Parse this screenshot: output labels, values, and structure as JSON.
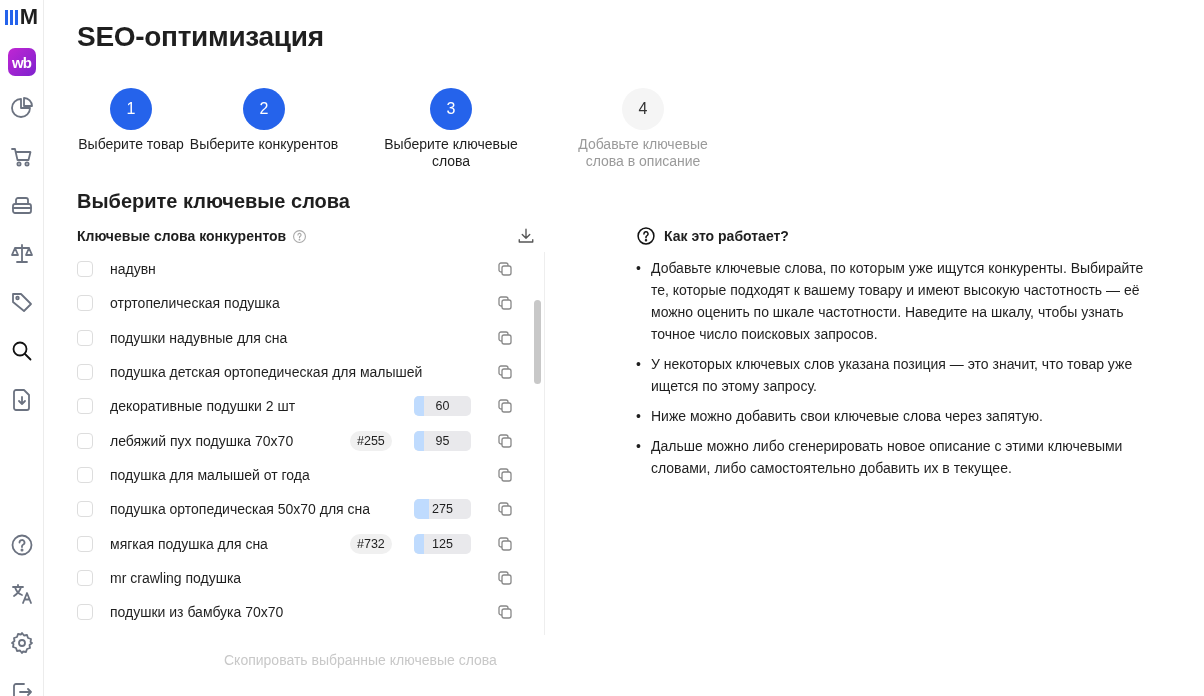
{
  "sidebar": {
    "logo": "M",
    "badge": "wb",
    "items": [
      {
        "selected": false
      },
      {
        "selected": false
      },
      {
        "selected": false
      },
      {
        "selected": false
      },
      {
        "selected": false
      },
      {
        "selected": true
      },
      {
        "selected": false
      }
    ]
  },
  "title": "SEO-оптимизация",
  "steps": [
    {
      "number": "1",
      "label": "Выберите товар",
      "enabled": true
    },
    {
      "number": "2",
      "label": "Выберите конкурентов",
      "enabled": true
    },
    {
      "number": "3",
      "label": "Выберите ключевые слова",
      "enabled": true
    },
    {
      "number": "4",
      "label": "Добавьте ключевые слова в описание",
      "enabled": false
    }
  ],
  "section_title": "Выберите ключевые слова",
  "keywords_panel": {
    "title": "Ключевые слова конкурентов",
    "keywords": [
      {
        "text": "надувн",
        "checked": false
      },
      {
        "text": "отртопелическая подушка",
        "checked": false
      },
      {
        "text": "подушки надувные для сна",
        "checked": false
      },
      {
        "text": "подушка детская ортопедическая для малышей",
        "checked": false
      },
      {
        "text": "декоративные подушки 2 шт",
        "checked": false,
        "frequency": "60",
        "level": 0.18
      },
      {
        "text": "лебяжий пух подушка 70x70",
        "checked": false,
        "position": "#255",
        "frequency": "95",
        "level": 0.18
      },
      {
        "text": "подушка для малышей от года",
        "checked": false
      },
      {
        "text": "подушка ортопедическая 50x70 для сна",
        "checked": false,
        "frequency": "275",
        "level": 0.27
      },
      {
        "text": "мягкая подушка для сна",
        "checked": false,
        "position": "#732",
        "frequency": "125",
        "level": 0.18
      },
      {
        "text": "mr crawling подушка",
        "checked": false
      },
      {
        "text": "подушки из бамбука 70x70",
        "checked": false
      }
    ],
    "copy_button": {
      "label": "Скопировать выбранные ключевые слова",
      "disabled": true
    }
  },
  "help": {
    "title": "Как это работает?",
    "items": [
      {
        "bullet": "•",
        "text": "Добавьте ключевые слова, по которым уже ищутся конкуренты. Выбирайте те, которые подходят к вашему товару и имеют высокую частотность — её можно оценить по шкале частотности. Наведите на шкалу, чтобы узнать точное число поисковых запросов."
      },
      {
        "bullet": "•",
        "text": "У некоторых ключевых слов указана позиция — это значит, что товар уже ищется по этому запросу."
      },
      {
        "bullet": "•",
        "text": "Ниже можно добавить свои ключевые слова через запятую."
      },
      {
        "bullet": "•",
        "text": "Дальше можно либо сгенерировать новое описание с этими ключевыми словами, либо самостоятельно добавить их в текущее."
      }
    ]
  }
}
